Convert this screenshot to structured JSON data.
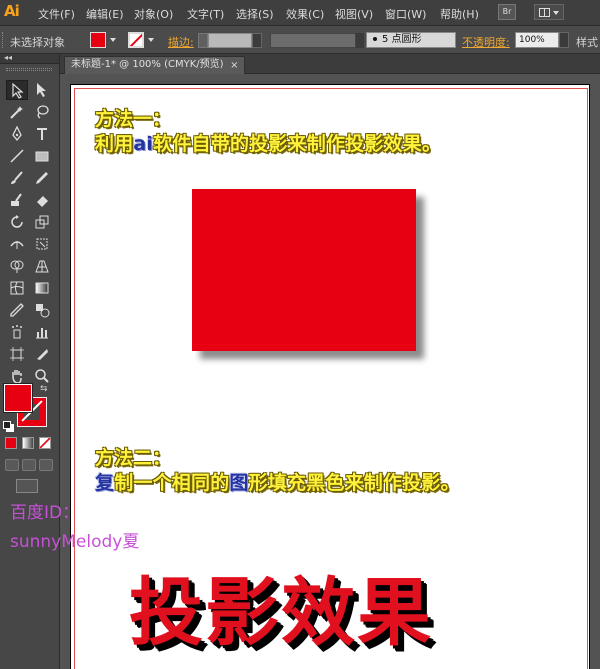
{
  "app": {
    "logo": "Ai"
  },
  "menu": {
    "items": [
      "文件(F)",
      "编辑(E)",
      "对象(O)",
      "文字(T)",
      "选择(S)",
      "效果(C)",
      "视图(V)",
      "窗口(W)",
      "帮助(H)"
    ],
    "bridge_button": "Br"
  },
  "control_bar": {
    "selection_status": "未选择对象",
    "fill_color": "#e60012",
    "stroke_label": "描边:",
    "brush": "5 点圆形",
    "opacity_label": "不透明度:",
    "opacity_value": "100%",
    "style_label": "样式"
  },
  "document_tab": {
    "title": "未标题-1* @ 100% (CMYK/预览)",
    "close": "×"
  },
  "artboard": {
    "method1_title": "方法一：",
    "method1_desc": {
      "part1": "利用",
      "part2": "ai",
      "part3": "软件自带的投影来制作投影效果。"
    },
    "square_color": "#e60012",
    "method2_title": "方法二：",
    "method2_desc": {
      "part1": "复",
      "part2": "制一个相同的",
      "part3": "图",
      "part4": "形填充黑色来制作投影。"
    },
    "big_title": "投影效果"
  },
  "watermark": {
    "line1": "百度ID：",
    "line2": "sunnyMelody夏"
  },
  "colors": {
    "accent_yellow": "#fff23a",
    "accent_red": "#e60012",
    "watermark": "#c850d8"
  }
}
